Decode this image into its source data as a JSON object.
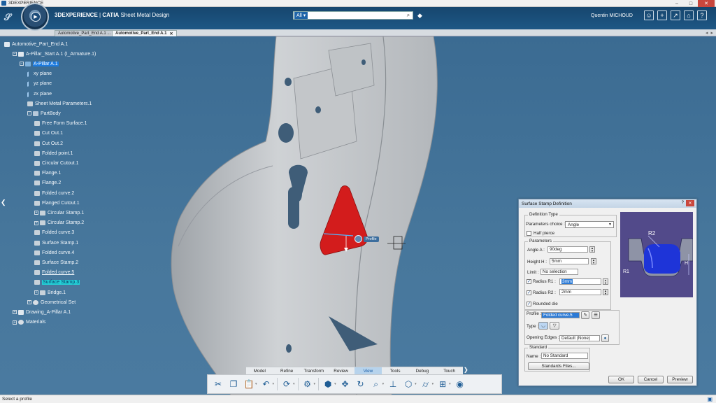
{
  "window": {
    "title": "3DEXPERIENCE",
    "controls": [
      "–",
      "□",
      "✕"
    ]
  },
  "header": {
    "brand": "3DEXPERIENCE",
    "app": "CATIA",
    "module": "Sheet Metal Design",
    "search": {
      "scope": "All",
      "placeholder": "",
      "value": ""
    },
    "user": "Quentin MICHOUD"
  },
  "tabs": [
    {
      "label": "Automotive_Part_End A.1 ...",
      "active": false
    },
    {
      "label": "Automotive_Part_End A.1",
      "active": true
    }
  ],
  "tree": [
    {
      "label": "Automotive_Part_End A.1",
      "level": 0,
      "icon": "product-icon",
      "state": ""
    },
    {
      "label": "A-Pillar_Start A.1 (I_Armature.1)",
      "level": 1,
      "icon": "product-icon",
      "state": ""
    },
    {
      "label": "A-Pillar A.1",
      "level": 2,
      "icon": "part-icon",
      "state": "selected"
    },
    {
      "label": "xy plane",
      "level": 3,
      "icon": "plane-icon",
      "state": ""
    },
    {
      "label": "yz plane",
      "level": 3,
      "icon": "plane-icon",
      "state": ""
    },
    {
      "label": "zx plane",
      "level": 3,
      "icon": "plane-icon",
      "state": ""
    },
    {
      "label": "Sheet Metal Parameters.1",
      "level": 3,
      "icon": "parameters-icon",
      "state": ""
    },
    {
      "label": "PartBody",
      "level": 3,
      "icon": "body-icon",
      "state": ""
    },
    {
      "label": "Free Form Surface.1",
      "level": 4,
      "icon": "feature-icon",
      "state": ""
    },
    {
      "label": "Cut Out.1",
      "level": 4,
      "icon": "feature-icon",
      "state": ""
    },
    {
      "label": "Cut Out.2",
      "level": 4,
      "icon": "feature-icon",
      "state": ""
    },
    {
      "label": "Folded point.1",
      "level": 4,
      "icon": "feature-icon",
      "state": ""
    },
    {
      "label": "Circular Cutout.1",
      "level": 4,
      "icon": "feature-icon",
      "state": ""
    },
    {
      "label": "Flange.1",
      "level": 4,
      "icon": "feature-icon",
      "state": ""
    },
    {
      "label": "Flange.2",
      "level": 4,
      "icon": "feature-icon",
      "state": ""
    },
    {
      "label": "Folded curve.2",
      "level": 4,
      "icon": "feature-icon",
      "state": ""
    },
    {
      "label": "Flanged Cutout.1",
      "level": 4,
      "icon": "feature-icon",
      "state": ""
    },
    {
      "label": "Circular Stamp.1",
      "level": 4,
      "icon": "feature-icon",
      "state": ""
    },
    {
      "label": "Circular Stamp.2",
      "level": 4,
      "icon": "feature-icon",
      "state": ""
    },
    {
      "label": "Folded curve.3",
      "level": 4,
      "icon": "feature-icon",
      "state": ""
    },
    {
      "label": "Surface Stamp.1",
      "level": 4,
      "icon": "feature-icon",
      "state": ""
    },
    {
      "label": "Folded curve.4",
      "level": 4,
      "icon": "feature-icon",
      "state": ""
    },
    {
      "label": "Surface Stamp.2",
      "level": 4,
      "icon": "feature-icon",
      "state": ""
    },
    {
      "label": "Folded curve.5",
      "level": 4,
      "icon": "feature-icon",
      "state": "underline"
    },
    {
      "label": "Surface Stamp.3",
      "level": 4,
      "icon": "feature-icon",
      "state": "highlight"
    },
    {
      "label": "Bridge.1",
      "level": 4,
      "icon": "feature-icon",
      "state": ""
    },
    {
      "label": "Geometrical Set",
      "level": 3,
      "icon": "geoset-icon",
      "state": ""
    },
    {
      "label": "Drawing_A-Pillar A.1",
      "level": 1,
      "icon": "drawing-icon",
      "state": ""
    },
    {
      "label": "Materials",
      "level": 1,
      "icon": "materials-icon",
      "state": ""
    }
  ],
  "viewport": {
    "profile_tag": "Profile"
  },
  "dialog": {
    "title": "Surface Stamp Definition",
    "help": "?",
    "definition_type": {
      "group": "Definition Type",
      "parameters_choice_label": "Parameters choice :",
      "parameters_choice_value": "Angle",
      "half_pierce_label": "Half pierce"
    },
    "parameters": {
      "group": "Parameters",
      "angle_label": "Angle A :",
      "angle_value": "90deg",
      "height_label": "Height H :",
      "height_value": "5mm",
      "limit_label": "Limit :",
      "limit_value": "No selection",
      "r1_label": "Radius R1 :",
      "r1_value": "3mm",
      "r2_label": "Radius R2 :",
      "r2_value": "2mm",
      "rounded_die_label": "Rounded die"
    },
    "profile": {
      "profile_label": "Profile :",
      "profile_value": "Folded curve.5",
      "type_label": "Type :",
      "opening_edges_label": "Opening Edges :",
      "opening_edges_value": "Default (None)"
    },
    "standard": {
      "group": "Standard",
      "name_label": "Name :",
      "name_value": "No Standard",
      "files_button": "Standards Files..."
    },
    "preview_labels": {
      "r1": "R1",
      "r2": "R2",
      "h": "H"
    },
    "buttons": {
      "ok": "OK",
      "cancel": "Cancel",
      "preview": "Preview"
    }
  },
  "action_tabs": [
    "Model",
    "Refine",
    "Transform",
    "Review",
    "View",
    "Tools",
    "Debug",
    "Touch"
  ],
  "active_action_tab": "View",
  "status": {
    "text": "Select a profile"
  },
  "colors": {
    "accent": "#1c7be0",
    "viewport_bg": "#3d6d94",
    "stamp_red": "#d31c1c",
    "part_grey": "#c8c8c8"
  }
}
